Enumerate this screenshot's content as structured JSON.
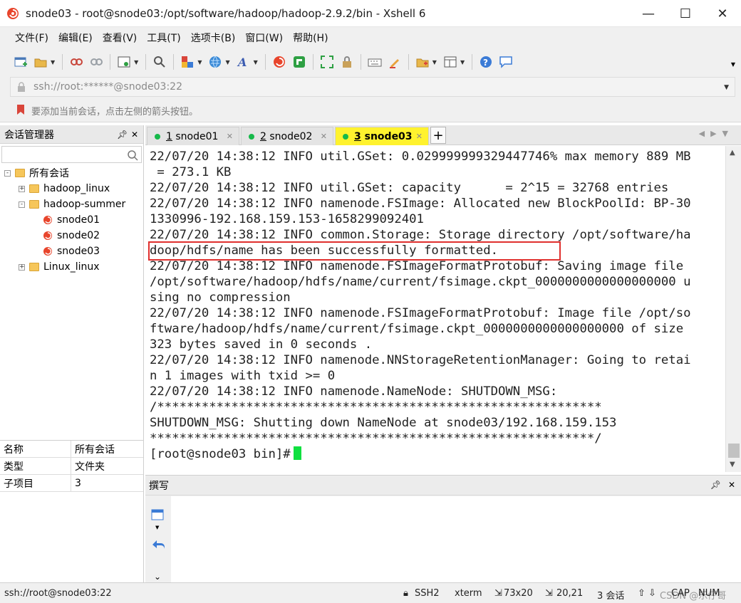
{
  "window": {
    "title": "snode03 - root@snode03:/opt/software/hadoop/hadoop-2.9.2/bin - Xshell 6",
    "minimize": "—",
    "maximize": "☐",
    "close": "✕"
  },
  "menu": [
    "文件(F)",
    "编辑(E)",
    "查看(V)",
    "工具(T)",
    "选项卡(B)",
    "窗口(W)",
    "帮助(H)"
  ],
  "address": {
    "value": "ssh://root:******@snode03:22"
  },
  "hint": "要添加当前会话，点击左侧的箭头按钮。",
  "session_manager": {
    "title": "会话管理器",
    "search_placeholder": "",
    "tree": [
      {
        "label": "所有会话",
        "type": "folder",
        "expander": "-"
      },
      {
        "label": "hadoop_linux",
        "type": "folder",
        "expander": "+"
      },
      {
        "label": "hadoop-summer",
        "type": "folder",
        "expander": "-"
      },
      {
        "label": "snode01",
        "type": "session"
      },
      {
        "label": "snode02",
        "type": "session"
      },
      {
        "label": "snode03",
        "type": "session"
      },
      {
        "label": "Linux_linux",
        "type": "folder",
        "expander": "+"
      }
    ],
    "properties": [
      {
        "key": "名称",
        "value": "所有会话"
      },
      {
        "key": "类型",
        "value": "文件夹"
      },
      {
        "key": "子项目",
        "value": "3"
      }
    ]
  },
  "tabs": [
    {
      "number": "1",
      "name": "snode01",
      "active": false
    },
    {
      "number": "2",
      "name": "snode02",
      "active": false
    },
    {
      "number": "3",
      "name": "snode03",
      "active": true
    }
  ],
  "terminal": {
    "lines": [
      "22/07/20 14:38:12 INFO util.GSet: 0.029999999329447746% max memory 889 MB",
      " = 273.1 KB",
      "22/07/20 14:38:12 INFO util.GSet: capacity      = 2^15 = 32768 entries",
      "22/07/20 14:38:12 INFO namenode.FSImage: Allocated new BlockPoolId: BP-30",
      "1330996-192.168.159.153-1658299092401",
      "22/07/20 14:38:12 INFO common.Storage: Storage directory /opt/software/ha",
      "doop/hdfs/name has been successfully formatted.",
      "22/07/20 14:38:12 INFO namenode.FSImageFormatProtobuf: Saving image file",
      "/opt/software/hadoop/hdfs/name/current/fsimage.ckpt_0000000000000000000 u",
      "sing no compression",
      "22/07/20 14:38:12 INFO namenode.FSImageFormatProtobuf: Image file /opt/so",
      "ftware/hadoop/hdfs/name/current/fsimage.ckpt_0000000000000000000 of size",
      "323 bytes saved in 0 seconds .",
      "22/07/20 14:38:12 INFO namenode.NNStorageRetentionManager: Going to retai",
      "n 1 images with txid >= 0",
      "22/07/20 14:38:12 INFO namenode.NameNode: SHUTDOWN_MSG:",
      "/************************************************************",
      "SHUTDOWN_MSG: Shutting down NameNode at snode03/192.168.159.153",
      "************************************************************/",
      "[root@snode03 bin]#"
    ],
    "cursor_color": "#10e040",
    "highlight_color": "#e0302e"
  },
  "compose": {
    "title": "撰写"
  },
  "status": {
    "connection": "ssh://root@snode03:22",
    "protocol": "SSH2",
    "terminal_type": "xterm",
    "size": "73x20",
    "cursor_pos": "20,21",
    "sessions": "3 会话",
    "caps": "CAP",
    "num": "NUM",
    "watermark": "CSDN @乐仔哥"
  }
}
